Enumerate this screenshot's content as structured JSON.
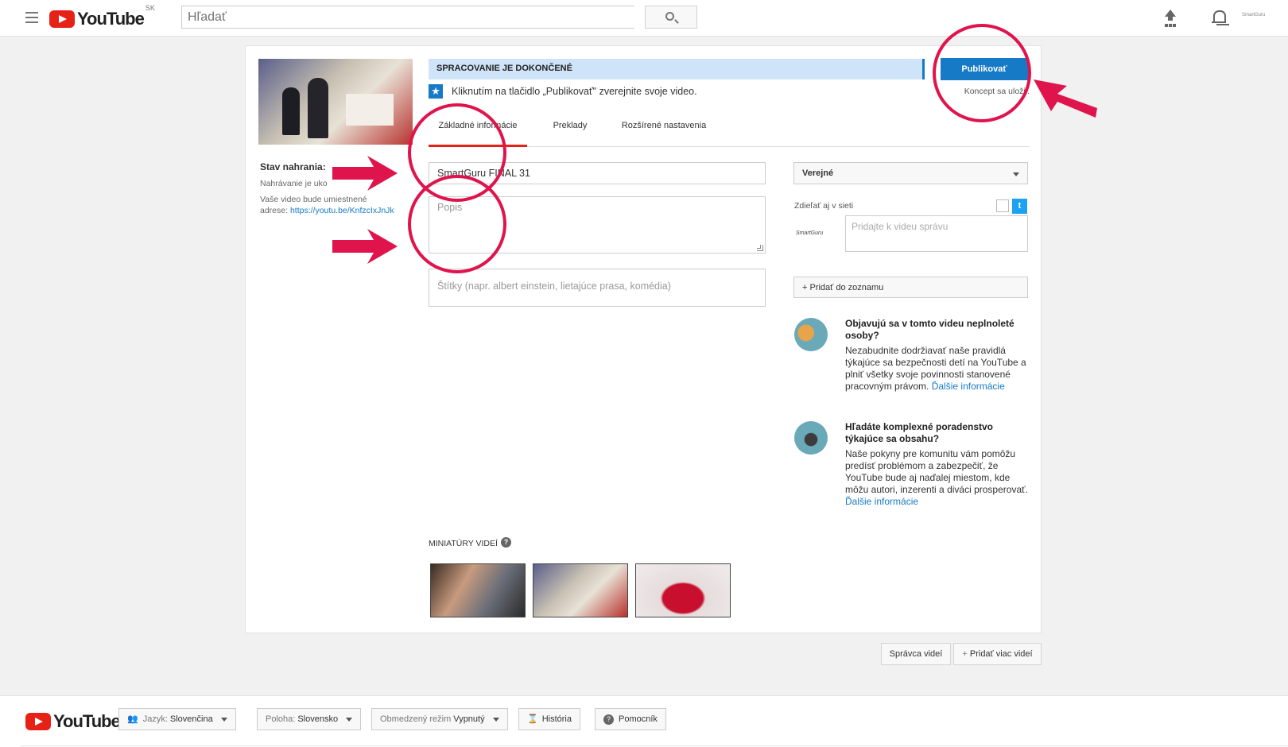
{
  "header": {
    "logo_text": "YouTube",
    "region": "SK",
    "search_placeholder": "Hľadať",
    "account_label": "SmartGuru"
  },
  "video": {
    "upload_status_title": "Stav nahrania:",
    "upload_status_text": "Nahrávanie je uko",
    "location_text_1": "Vaše video bude umiestnené",
    "location_text_2": "adrese:",
    "video_url": "https://youtu.be/KnfzcIxJnJk"
  },
  "progress": {
    "label": "SPRACOVANIE JE DOKONČENÉ"
  },
  "publish": {
    "button_label": "Publikovať",
    "draft_status": "Koncept sa uložil."
  },
  "hint": "Kliknutím na tlačidlo „Publikovať\" zverejnite svoje video.",
  "tabs": [
    {
      "label": "Základné informácie",
      "active": true
    },
    {
      "label": "Preklady",
      "active": false
    },
    {
      "label": "Rozšírené nastavenia",
      "active": false
    }
  ],
  "form": {
    "title_value": "SmartGuru FINAL 31",
    "description_placeholder": "Popis",
    "tags_placeholder": "Štítky (napr. albert einstein, lietajúce prasa, komédia)"
  },
  "privacy": {
    "selected": "Verejné",
    "share_label": "Zdieľať aj v sieti",
    "channel_name": "SmartGuru",
    "message_placeholder": "Pridajte k videu správu",
    "playlist_button": "+ Pridať do zoznamu"
  },
  "info": [
    {
      "title": "Objavujú sa v tomto videu neplnoleté osoby?",
      "text": "Nezabudnite dodržiavať naše pravidlá týkajúce sa bezpečnosti detí na YouTube a plniť všetky svoje povinnosti stanovené pracovným právom.",
      "link": "Ďalšie informácie"
    },
    {
      "title": "Hľadáte komplexné poradenstvo týkajúce sa obsahu?",
      "text": "Naše pokyny pre komunitu vám pomôžu predísť problémom a zabezpečiť, že YouTube bude aj naďalej miestom, kde môžu autori, inzerenti a diváci prosperovať.",
      "link": "Ďalšie informácie"
    }
  ],
  "thumbnails": {
    "label": "MINIATÚRY VIDEÍ"
  },
  "actions": {
    "video_manager": "Správca videí",
    "add_more": "Pridať viac videí"
  },
  "footer": {
    "logo_text": "YouTube",
    "language_key": "Jazyk:",
    "language_value": "Slovenčina",
    "location_key": "Poloha:",
    "location_value": "Slovensko",
    "restricted_key": "Obmedzený režim",
    "restricted_value": "Vypnutý",
    "history": "História",
    "help": "Pomocník"
  },
  "colors": {
    "accent_blue": "#167ac6",
    "youtube_red": "#e62117",
    "annotation": "#e0144c"
  }
}
